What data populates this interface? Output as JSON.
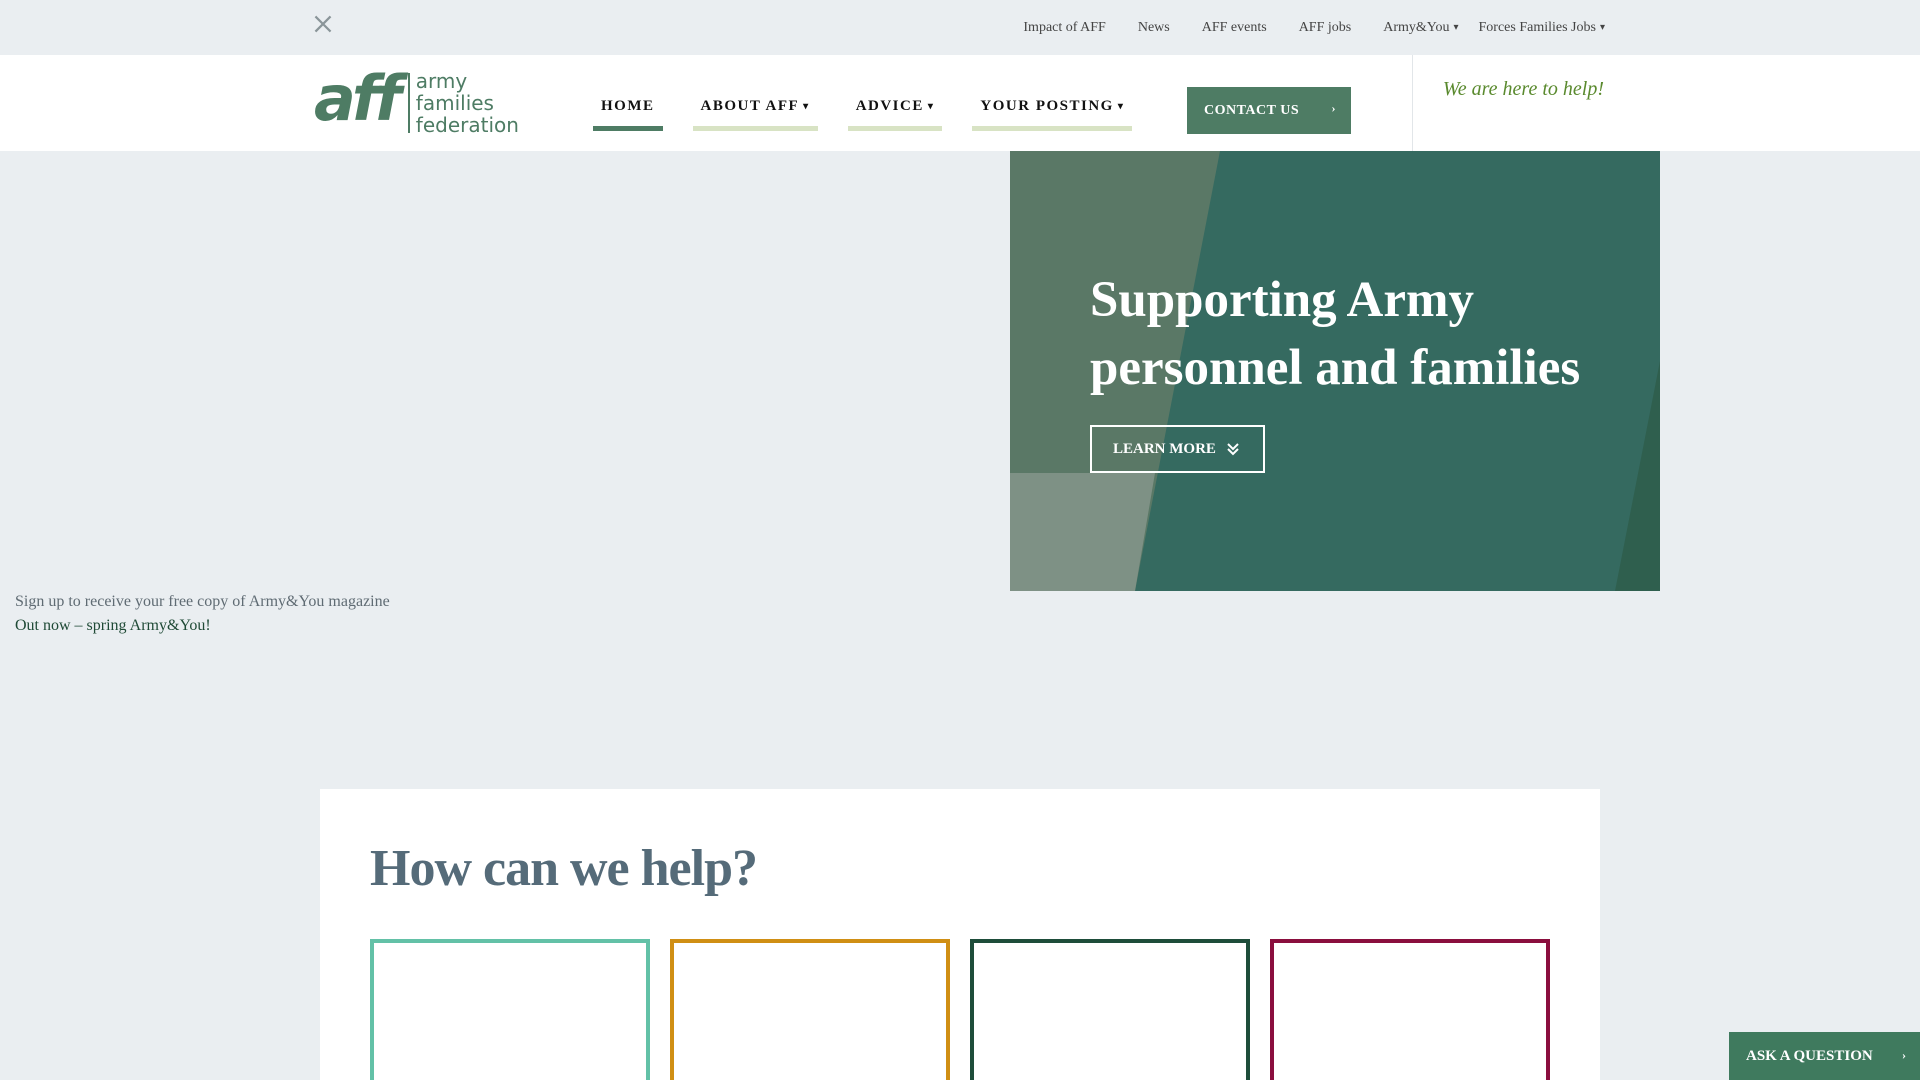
{
  "colors": {
    "brand_green": "#4e7c64",
    "hero_green": "#356a60",
    "accent_lime": "#5a8a2e",
    "card_teal": "#63c1a7",
    "card_gold": "#d08f14",
    "card_dark_green": "#1e4d3a",
    "card_crimson": "#8a0e3e"
  },
  "topbar": {
    "social_icon": "x-twitter-icon",
    "links": [
      {
        "label": "Impact of AFF"
      },
      {
        "label": "News"
      },
      {
        "label": "AFF events"
      },
      {
        "label": "AFF jobs"
      },
      {
        "label": "Army&You",
        "dropdown": true
      },
      {
        "label": "Forces Families Jobs",
        "dropdown": true
      }
    ]
  },
  "header": {
    "logo": {
      "mark": "aff",
      "line1": "army",
      "line2": "families",
      "line3": "federation"
    },
    "nav": [
      {
        "label": "HOME",
        "active": true
      },
      {
        "label": "ABOUT AFF",
        "dropdown": true
      },
      {
        "label": "ADVICE",
        "dropdown": true
      },
      {
        "label": "YOUR POSTING",
        "dropdown": true
      }
    ],
    "contact_label": "CONTACT US",
    "tagline": "We are here to help!"
  },
  "hero": {
    "title": "Supporting Army personnel and families",
    "button_label": "LEARN MORE"
  },
  "magazine": {
    "signup_text": "Sign up to receive your free copy of Army&You magazine",
    "link_text": "Out now – spring Army&You!"
  },
  "help": {
    "title": "How can we help?",
    "cards": [
      {
        "color": "#63c1a7"
      },
      {
        "color": "#d08f14"
      },
      {
        "color": "#1e4d3a"
      },
      {
        "color": "#8a0e3e"
      }
    ]
  },
  "floating": {
    "ask_label": "ASK A QUESTION"
  }
}
